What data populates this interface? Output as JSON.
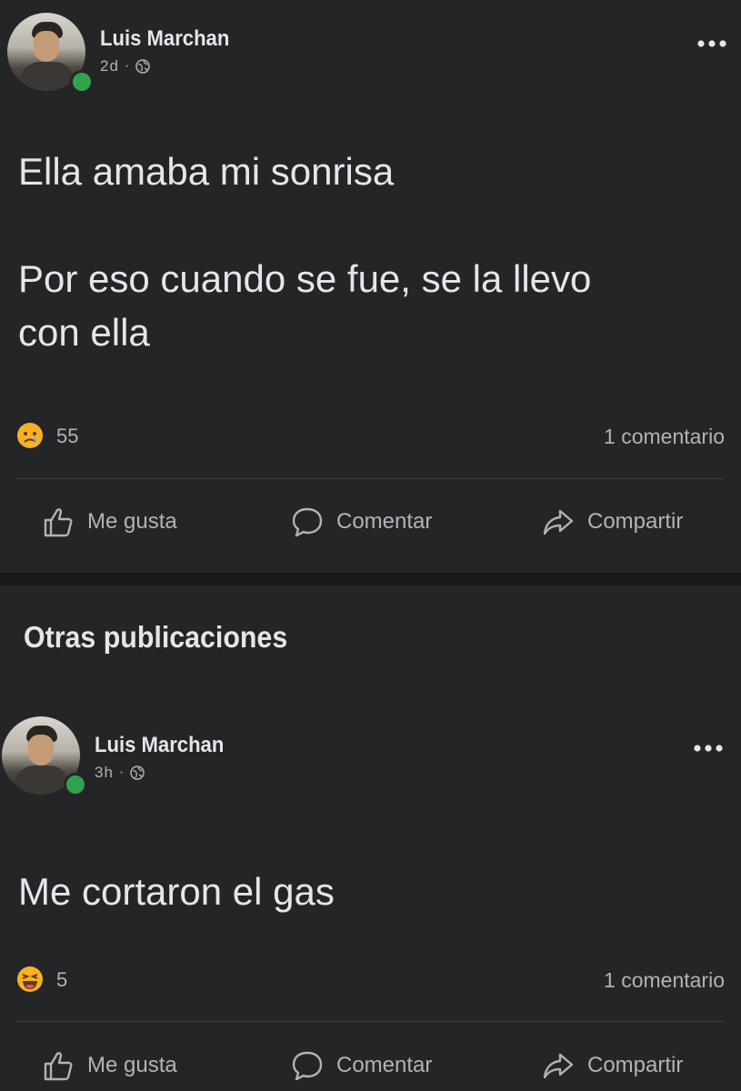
{
  "posts": [
    {
      "author": "Luis Marchan",
      "time": "2d",
      "text": "Ella amaba mi sonrisa\n\nPor eso cuando se fue, se la llevo\ncon ella",
      "reaction_icon": "sad-emoji-icon",
      "reaction_count": "55",
      "comments": "1 comentario"
    },
    {
      "author": "Luis Marchan",
      "time": "3h",
      "text": "Me cortaron el gas",
      "reaction_icon": "haha-emoji-icon",
      "reaction_count": "5",
      "comments": "1 comentario"
    }
  ],
  "actions": {
    "like": "Me gusta",
    "comment": "Comentar",
    "share": "Compartir"
  },
  "section_title": "Otras publicaciones",
  "colors": {
    "background": "#242526",
    "separator": "#18191a",
    "text_primary": "#e4e6eb",
    "text_secondary": "#b0b3b8",
    "online": "#31a24c",
    "reaction_yellow": "#f7b125"
  }
}
